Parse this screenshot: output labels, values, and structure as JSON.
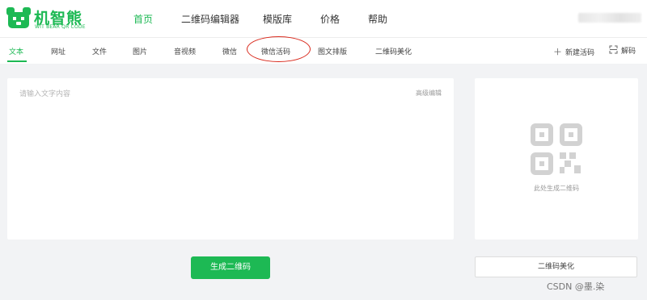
{
  "brand": {
    "name": "机智熊",
    "tagline": "WIT BEAR QR CODE",
    "color": "#1db954"
  },
  "nav": {
    "items": [
      "首页",
      "二维码编辑器",
      "模版库",
      "价格",
      "帮助"
    ],
    "active_index": 0
  },
  "tabs": {
    "items": [
      "文本",
      "网址",
      "文件",
      "图片",
      "音视频",
      "微信",
      "微信活码",
      "图文排版",
      "二维码美化"
    ],
    "active_index": 0,
    "circled": "微信活码"
  },
  "tools": {
    "new_live_code": "新建活码",
    "new_live_code_icon": "plus-icon",
    "decode": "解码",
    "decode_icon": "scan-icon"
  },
  "editor": {
    "placeholder": "请输入文字内容",
    "advanced_edit": "高级编辑"
  },
  "actions": {
    "generate": "生成二维码"
  },
  "preview": {
    "hint": "此处生成二维码",
    "icon": "qr-placeholder-icon",
    "beautify": "二维码美化"
  },
  "watermark": "CSDN @墨.染"
}
